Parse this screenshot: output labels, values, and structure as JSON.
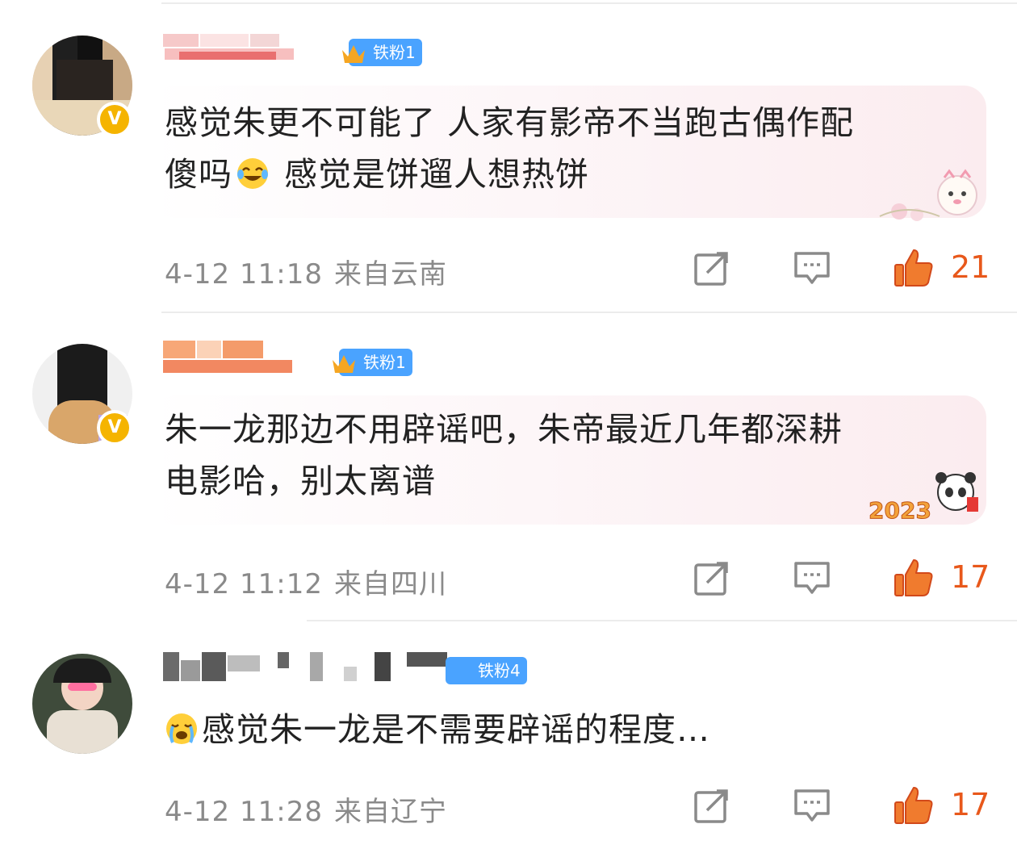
{
  "comments": [
    {
      "fan_badge": "铁粉1",
      "text_line1": "感觉朱更不可能了 人家有影帝不当跑古偶作配",
      "text_line2a": "傻吗",
      "text_line2b": " 感觉是饼遛人想热饼",
      "emoji": "laughing-tears-emoji",
      "time": "4-12 11:18",
      "location": "来自云南",
      "likes": "21"
    },
    {
      "fan_badge": "铁粉1",
      "text_line1": "朱一龙那边不用辟谣吧，朱帝最近几年都深耕",
      "text_line2": "电影哈，别太离谱",
      "sticker_text": "2023",
      "time": "4-12 11:12",
      "location": "来自四川",
      "likes": "17"
    },
    {
      "fan_badge": "铁粉4",
      "text_line1": "感觉朱一龙是不需要辟谣的程度…",
      "emoji": "crying-emoji",
      "time": "4-12 11:28",
      "location": "来自辽宁",
      "likes": "17"
    }
  ],
  "colors": {
    "accent_like": "#e8581b",
    "fan_badge": "#4aa3ff",
    "verified": "#f5b400",
    "meta_text": "#8a8a8a"
  }
}
